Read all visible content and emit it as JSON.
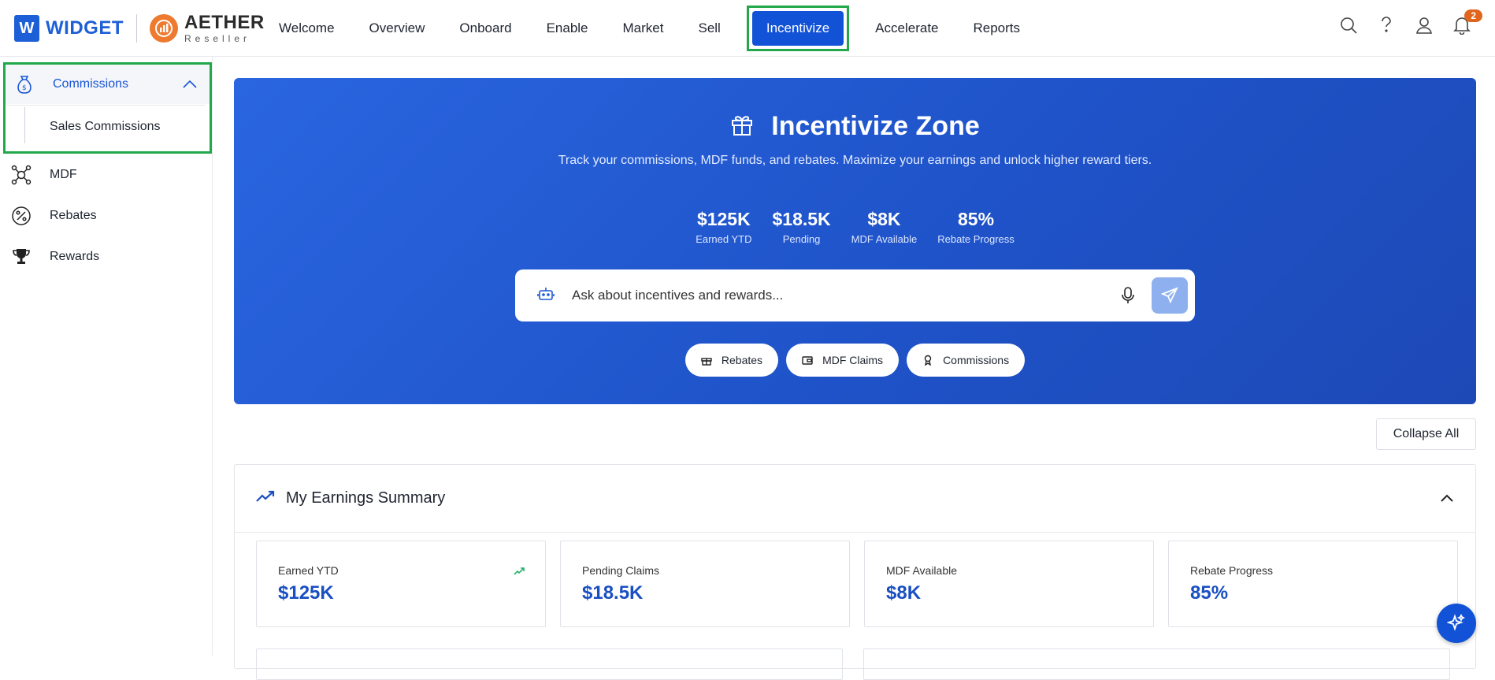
{
  "brand": {
    "w_letter": "W",
    "widget_name": "WIDGET",
    "aether_name": "AETHER",
    "aether_sub": "Reseller"
  },
  "nav": {
    "items": [
      "Welcome",
      "Overview",
      "Onboard",
      "Enable",
      "Market",
      "Sell"
    ],
    "active": "Incentivize",
    "after": [
      "Accelerate",
      "Reports"
    ]
  },
  "top_icons": {
    "notifications_count": "2"
  },
  "sidebar": {
    "group_label": "Commissions",
    "sub_item": "Sales Commissions",
    "items": [
      "MDF",
      "Rebates",
      "Rewards"
    ]
  },
  "hero": {
    "title": "Incentivize Zone",
    "description": "Track your commissions, MDF funds, and rebates. Maximize your earnings and unlock higher reward tiers.",
    "stats": [
      {
        "value": "$125K",
        "label": "Earned YTD"
      },
      {
        "value": "$18.5K",
        "label": "Pending"
      },
      {
        "value": "$8K",
        "label": "MDF Available"
      },
      {
        "value": "85%",
        "label": "Rebate Progress"
      }
    ],
    "search_placeholder": "Ask about incentives and rewards...",
    "chips": [
      "Rebates",
      "MDF Claims",
      "Commissions"
    ]
  },
  "actions": {
    "collapse_all": "Collapse All"
  },
  "earnings": {
    "title": "My Earnings Summary",
    "cards": [
      {
        "label": "Earned YTD",
        "value": "$125K"
      },
      {
        "label": "Pending Claims",
        "value": "$18.5K"
      },
      {
        "label": "MDF Available",
        "value": "$8K"
      },
      {
        "label": "Rebate Progress",
        "value": "85%"
      }
    ]
  },
  "colors": {
    "primary": "#1152d6",
    "highlight_border": "#22a84a",
    "badge": "#e0651d",
    "trend_green": "#22b36a"
  }
}
